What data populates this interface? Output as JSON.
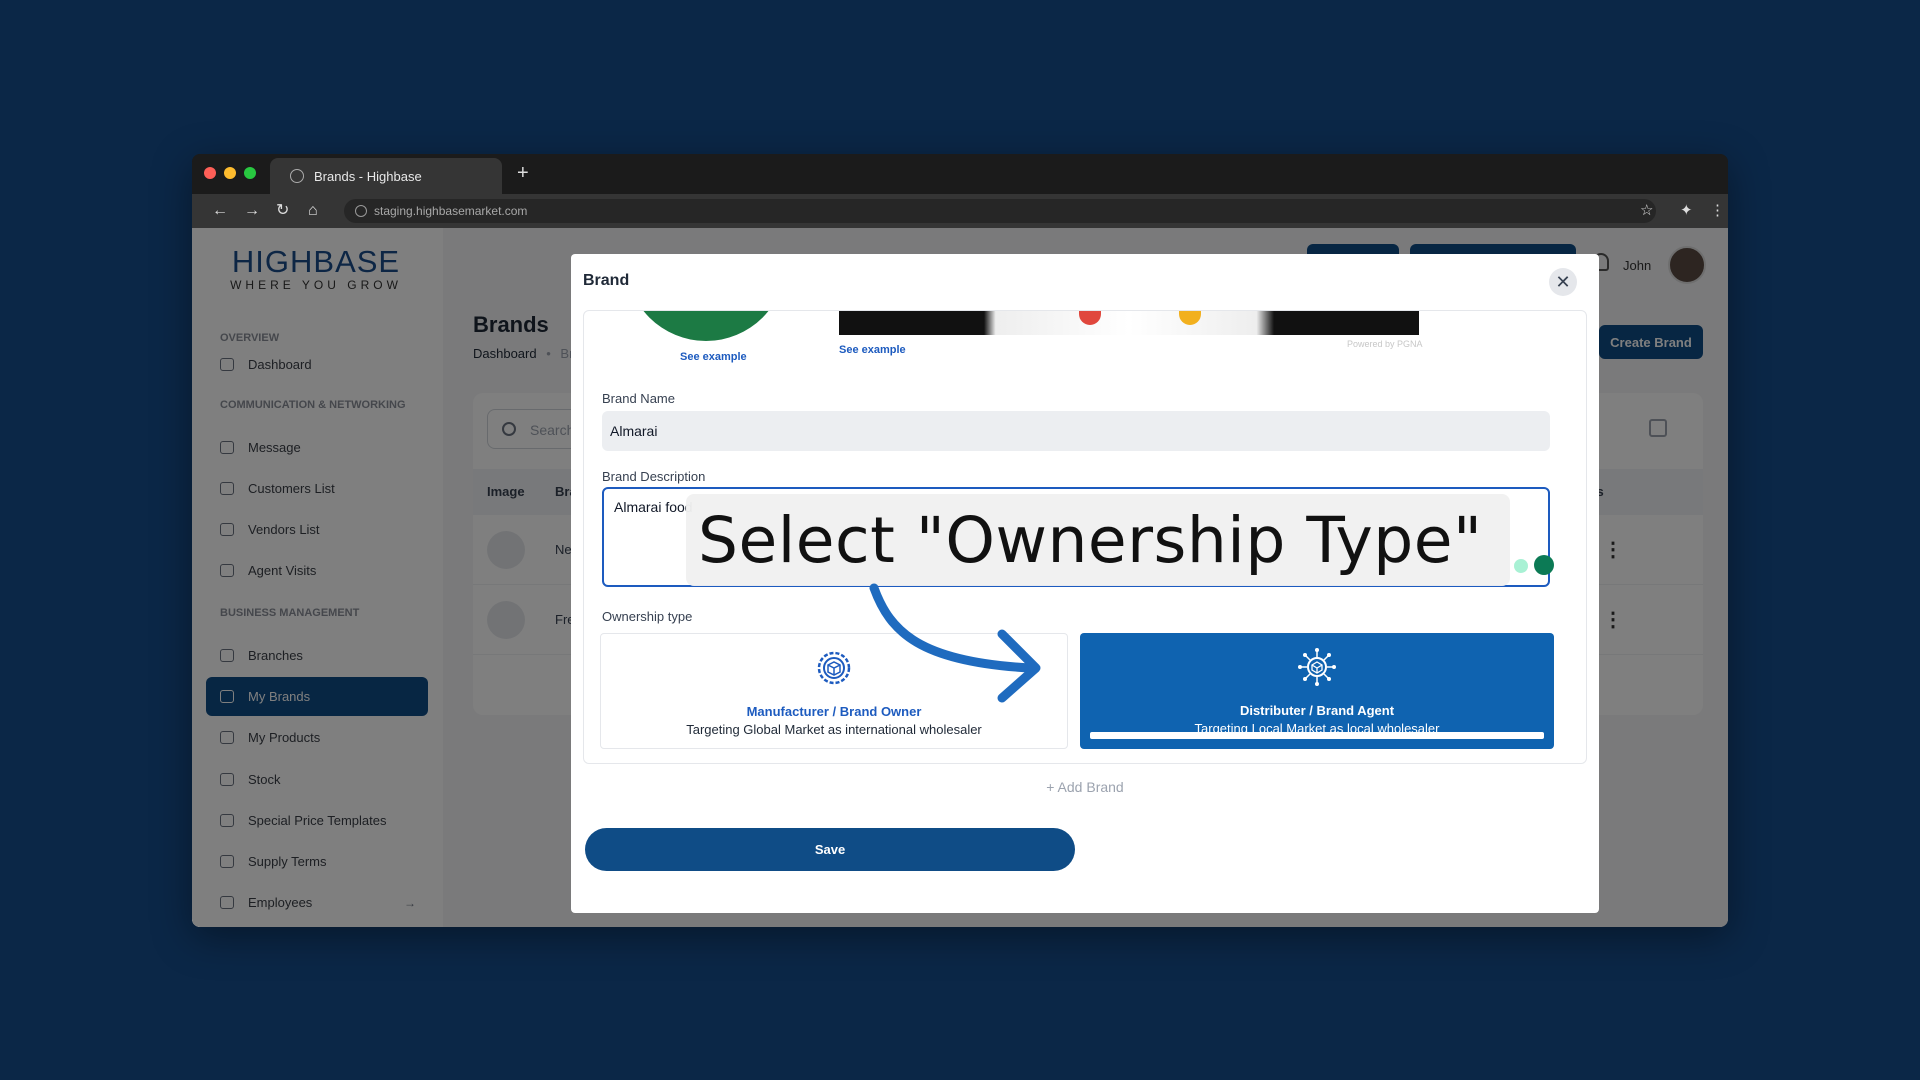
{
  "browser": {
    "tab_title": "Brands - Highbase",
    "new_tab": "+",
    "url": "staging.highbasemarket.com"
  },
  "logo": {
    "name": "HIGHBASE",
    "tagline": "WHERE YOU GROW"
  },
  "sidebar": {
    "sections": {
      "overview": "OVERVIEW",
      "communication": "COMMUNICATION & NETWORKING",
      "business": "BUSINESS MANAGEMENT"
    },
    "items": [
      {
        "label": "Dashboard",
        "icon": "home-icon"
      },
      {
        "label": "Message",
        "icon": "message-icon"
      },
      {
        "label": "Customers List",
        "icon": "users-icon"
      },
      {
        "label": "Vendors List",
        "icon": "users-icon"
      },
      {
        "label": "Agent Visits",
        "icon": "truck-icon"
      },
      {
        "label": "Branches",
        "icon": "store-icon"
      },
      {
        "label": "My Brands",
        "icon": "star-icon",
        "active": true
      },
      {
        "label": "My Products",
        "icon": "box-icon"
      },
      {
        "label": "Stock",
        "icon": "box-icon"
      },
      {
        "label": "Special Price Templates",
        "icon": "list-icon"
      },
      {
        "label": "Supply Terms",
        "icon": "info-icon"
      },
      {
        "label": "Employees",
        "icon": "users-icon"
      }
    ]
  },
  "header": {
    "user_name": "John"
  },
  "page": {
    "title": "Brands",
    "breadcrumb": "Dashboard",
    "breadcrumb_sep": "•",
    "breadcrumb_current": "Br",
    "create_button": "Create Brand",
    "search_placeholder": "Search",
    "table_headers": [
      "Image",
      "Bra",
      "ions"
    ],
    "rows": [
      {
        "name": "Ne"
      },
      {
        "name": "Fre"
      }
    ]
  },
  "modal": {
    "title": "Brand",
    "see_example_1": "See example",
    "see_example_2": "See example",
    "powered_by": "Powered by PGNA",
    "brand_name_label": "Brand Name",
    "brand_name_value": "Almarai",
    "brand_description_label": "Brand Description",
    "brand_description_value": "Almarai food",
    "ownership_label": "Ownership type",
    "ownership_options": [
      {
        "title": "Manufacturer / Brand Owner",
        "subtitle": "Targeting Global Market as international wholesaler",
        "selected": false
      },
      {
        "title": "Distributer / Brand Agent",
        "subtitle": "Targeting Local Market as local wholesaler",
        "selected": true
      }
    ],
    "add_brand": "+ Add Brand",
    "save": "Save"
  },
  "callout": {
    "text": "Select \"Ownership Type\""
  },
  "colors": {
    "background": "#0b2747",
    "primary": "#0f4c86",
    "selected_card": "#0f63b0",
    "arrow": "#1f6bbf"
  }
}
